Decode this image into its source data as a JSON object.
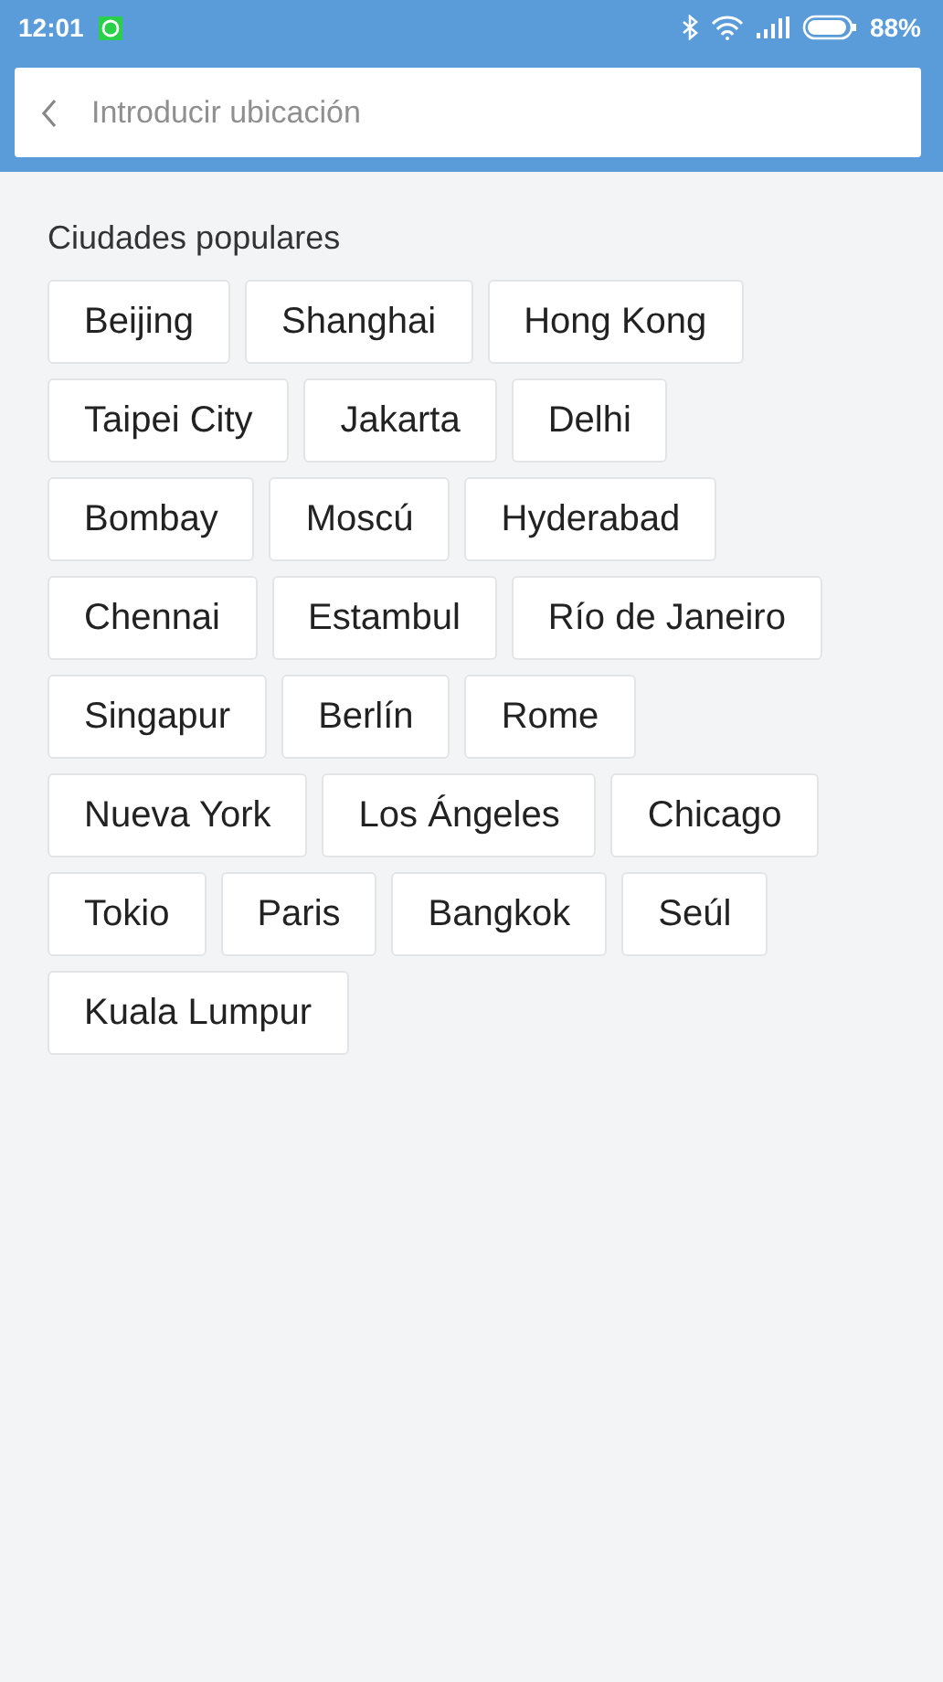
{
  "status_bar": {
    "time": "12:01",
    "battery": "88%"
  },
  "search": {
    "placeholder": "Introducir ubicación"
  },
  "section_title": "Ciudades populares",
  "cities": [
    "Beijing",
    "Shanghai",
    "Hong Kong",
    "Taipei City",
    "Jakarta",
    "Delhi",
    "Bombay",
    "Moscú",
    "Hyderabad",
    "Chennai",
    "Estambul",
    "Río de Janeiro",
    "Singapur",
    "Berlín",
    "Rome",
    "Nueva York",
    "Los Ángeles",
    "Chicago",
    "Tokio",
    "Paris",
    "Bangkok",
    "Seúl",
    "Kuala Lumpur"
  ]
}
